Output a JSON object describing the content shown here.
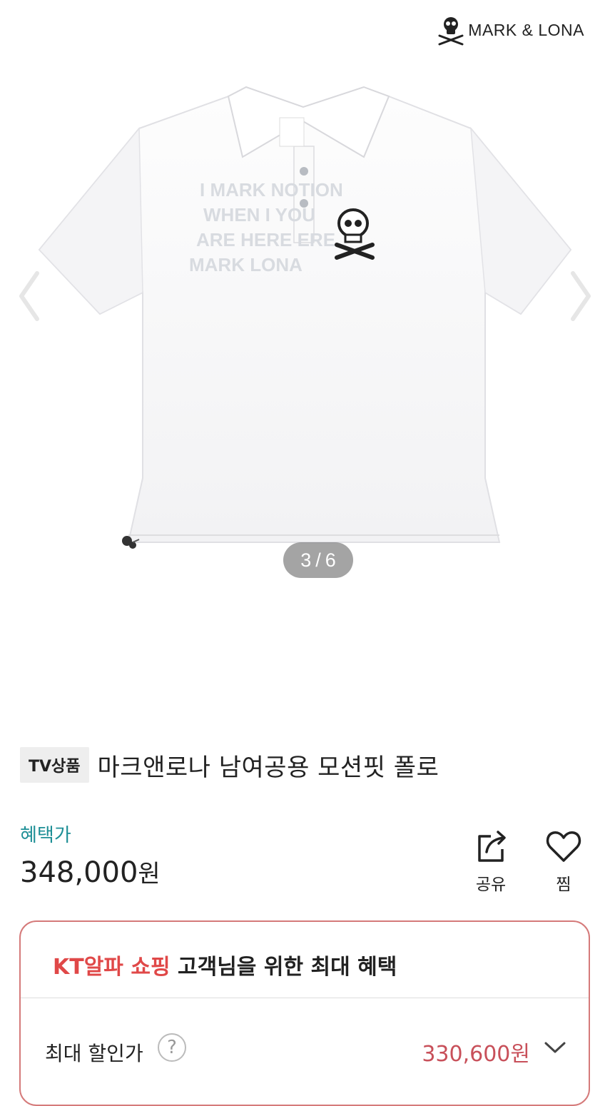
{
  "brand": {
    "name": "MARK & LONA",
    "logo_icon": "skull-crossbones-icon"
  },
  "gallery": {
    "current": "3",
    "separator": "/",
    "total": "6",
    "prev_icon": "chevron-left-icon",
    "next_icon": "chevron-right-icon"
  },
  "product": {
    "badge": "TV상품",
    "title": "마크앤로나 남여공용 모션핏 폴로",
    "price_label": "혜택가",
    "price": "348,000",
    "price_unit": "원"
  },
  "actions": {
    "share_label": "공유",
    "like_label": "찜",
    "share_icon": "share-icon",
    "like_icon": "heart-icon"
  },
  "benefit": {
    "head_accent": "KT알파 쇼핑",
    "head_rest": " 고객님을 위한 최대 혜택",
    "discount_label": "최대 할인가",
    "help_glyph": "?",
    "discount_price": "330,600원",
    "expand_icon": "chevron-down-icon"
  },
  "colors": {
    "accent_teal": "#1e8f96",
    "accent_red": "#e04848",
    "border_pink": "#d57a7a",
    "discount_red": "#c8505a"
  }
}
